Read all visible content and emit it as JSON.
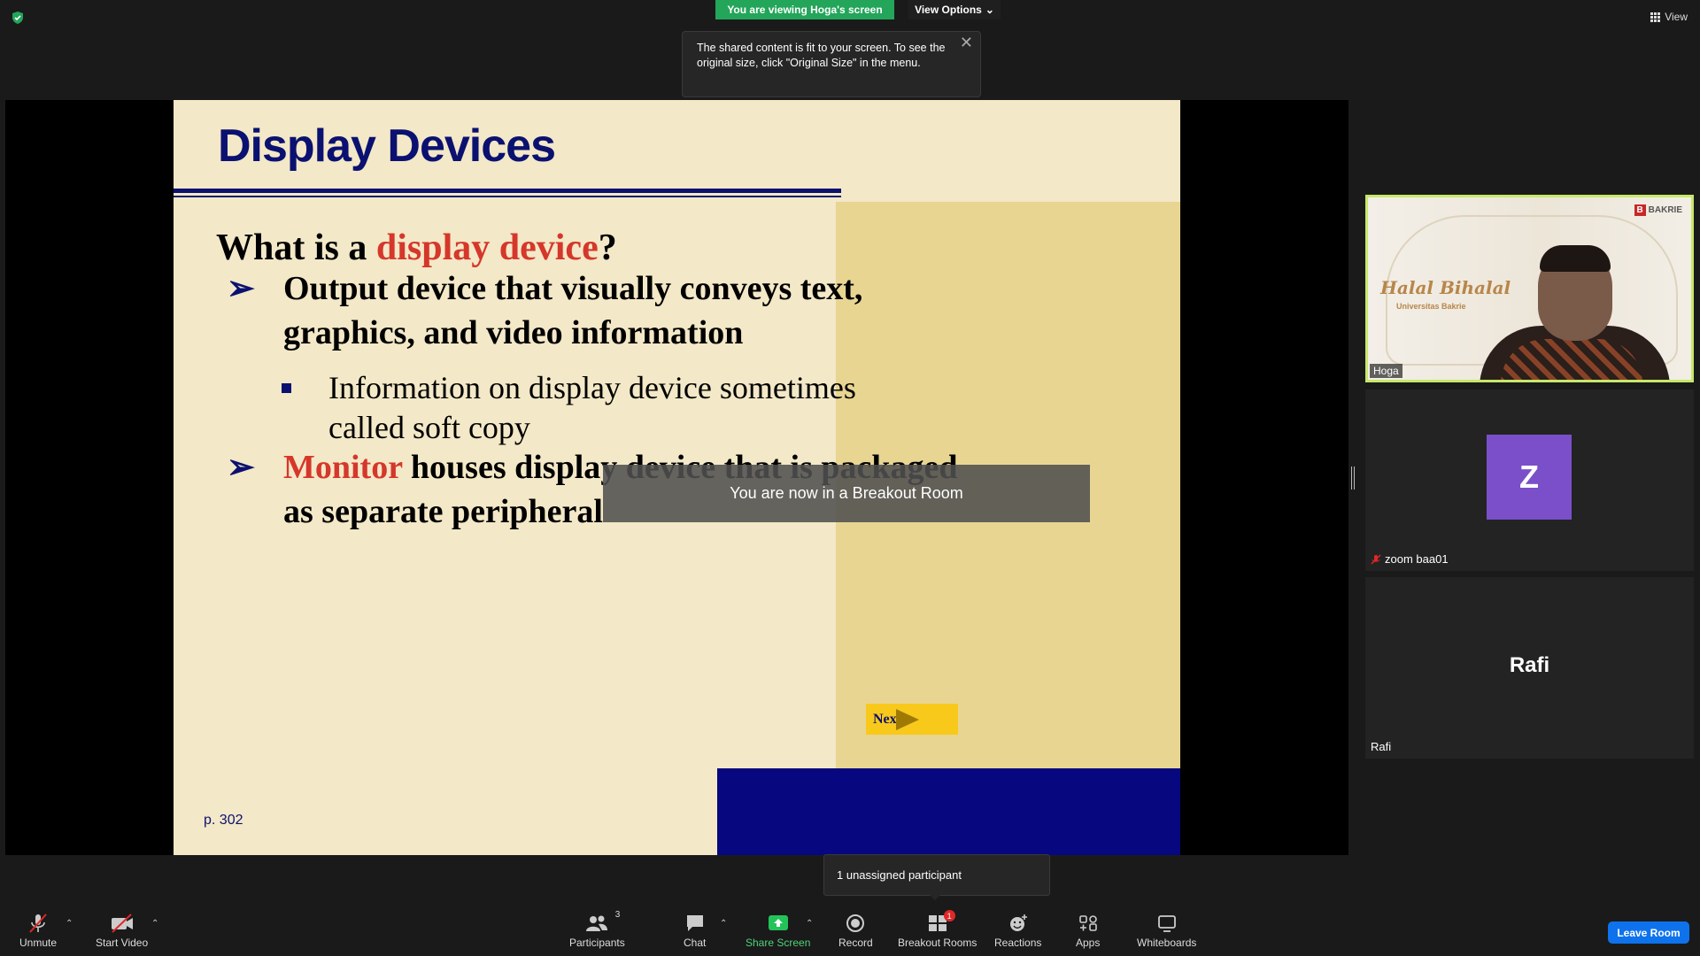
{
  "top": {
    "viewing_banner": "You are viewing Hoga's screen",
    "view_options": "View Options",
    "view": "View"
  },
  "tooltip": {
    "text": "The shared content is fit to your screen. To see the original size, click \"Original Size\" in the menu."
  },
  "slide": {
    "title": "Display Devices",
    "question_prefix": "What is a ",
    "question_highlight": "display device",
    "question_suffix": "?",
    "bullet1_line1": "Output device that visually conveys text,",
    "bullet1_line2": "graphics, and video information",
    "sub1_line1": "Information on display device sometimes",
    "sub1_line2": "called soft copy",
    "bullet2_highlight": "Monitor",
    "bullet2_line1_rest": " houses display device that is packaged",
    "bullet2_line2": "as separate peripheral",
    "page_ref": "p. 302",
    "next": "Next"
  },
  "breakout_toast": "You are now in a Breakout Room",
  "participants": [
    {
      "name": "Hoga",
      "background_title": "Halal Bihalal",
      "background_subtitle": "Universitas Bakrie",
      "logo_text": "BAKRIE",
      "logo_mark": "B"
    },
    {
      "name": "zoom baa01",
      "avatar_letter": "Z",
      "avatar_color": "#7a4fc9",
      "muted": true
    },
    {
      "name": "Rafi",
      "display_name": "Rafi"
    }
  ],
  "unassigned_popup": "1 unassigned participant",
  "toolbar": {
    "unmute": "Unmute",
    "start_video": "Start Video",
    "participants": "Participants",
    "participants_count": "3",
    "chat": "Chat",
    "share_screen": "Share Screen",
    "record": "Record",
    "breakout_rooms": "Breakout Rooms",
    "breakout_badge": "1",
    "reactions": "Reactions",
    "apps": "Apps",
    "whiteboards": "Whiteboards",
    "leave_room": "Leave Room"
  },
  "colors": {
    "banner_green": "#23a55a",
    "active_speaker_border": "#c7e86a",
    "leave_blue": "#0e72ed",
    "slide_navy": "#0b1170",
    "slide_red": "#d5372b"
  }
}
